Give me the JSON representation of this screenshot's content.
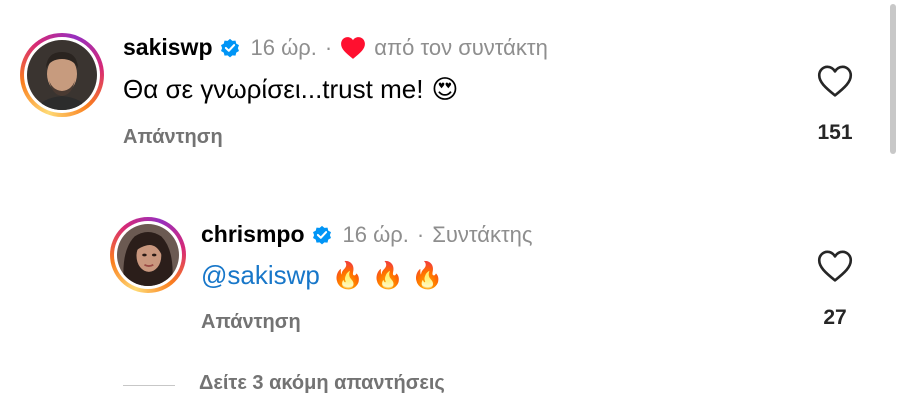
{
  "comments": [
    {
      "username": "sakiswp",
      "verified": true,
      "time": "16 ώρ.",
      "liked_by_author_label": "από τον συντάκτη",
      "text": "Θα σε γνωρίσει...trust me!",
      "emoji": "😍",
      "reply_label": "Απάντηση",
      "likes": "151"
    },
    {
      "username": "chrismpo",
      "verified": true,
      "time": "16 ώρ.",
      "author_label": "Συντάκτης",
      "mention": "@sakiswp",
      "emoji": "🔥 🔥 🔥",
      "reply_label": "Απάντηση",
      "likes": "27"
    }
  ],
  "more_replies_label": "Δείτε 3 ακόμη απαντήσεις",
  "colors": {
    "verified": "#0095f6",
    "heart_red": "#ff0f2f",
    "mention": "#1877c9",
    "meta_gray": "#8e8e8e"
  },
  "icons": [
    "verified-badge-icon",
    "heart-filled-icon",
    "heart-outline-icon"
  ]
}
